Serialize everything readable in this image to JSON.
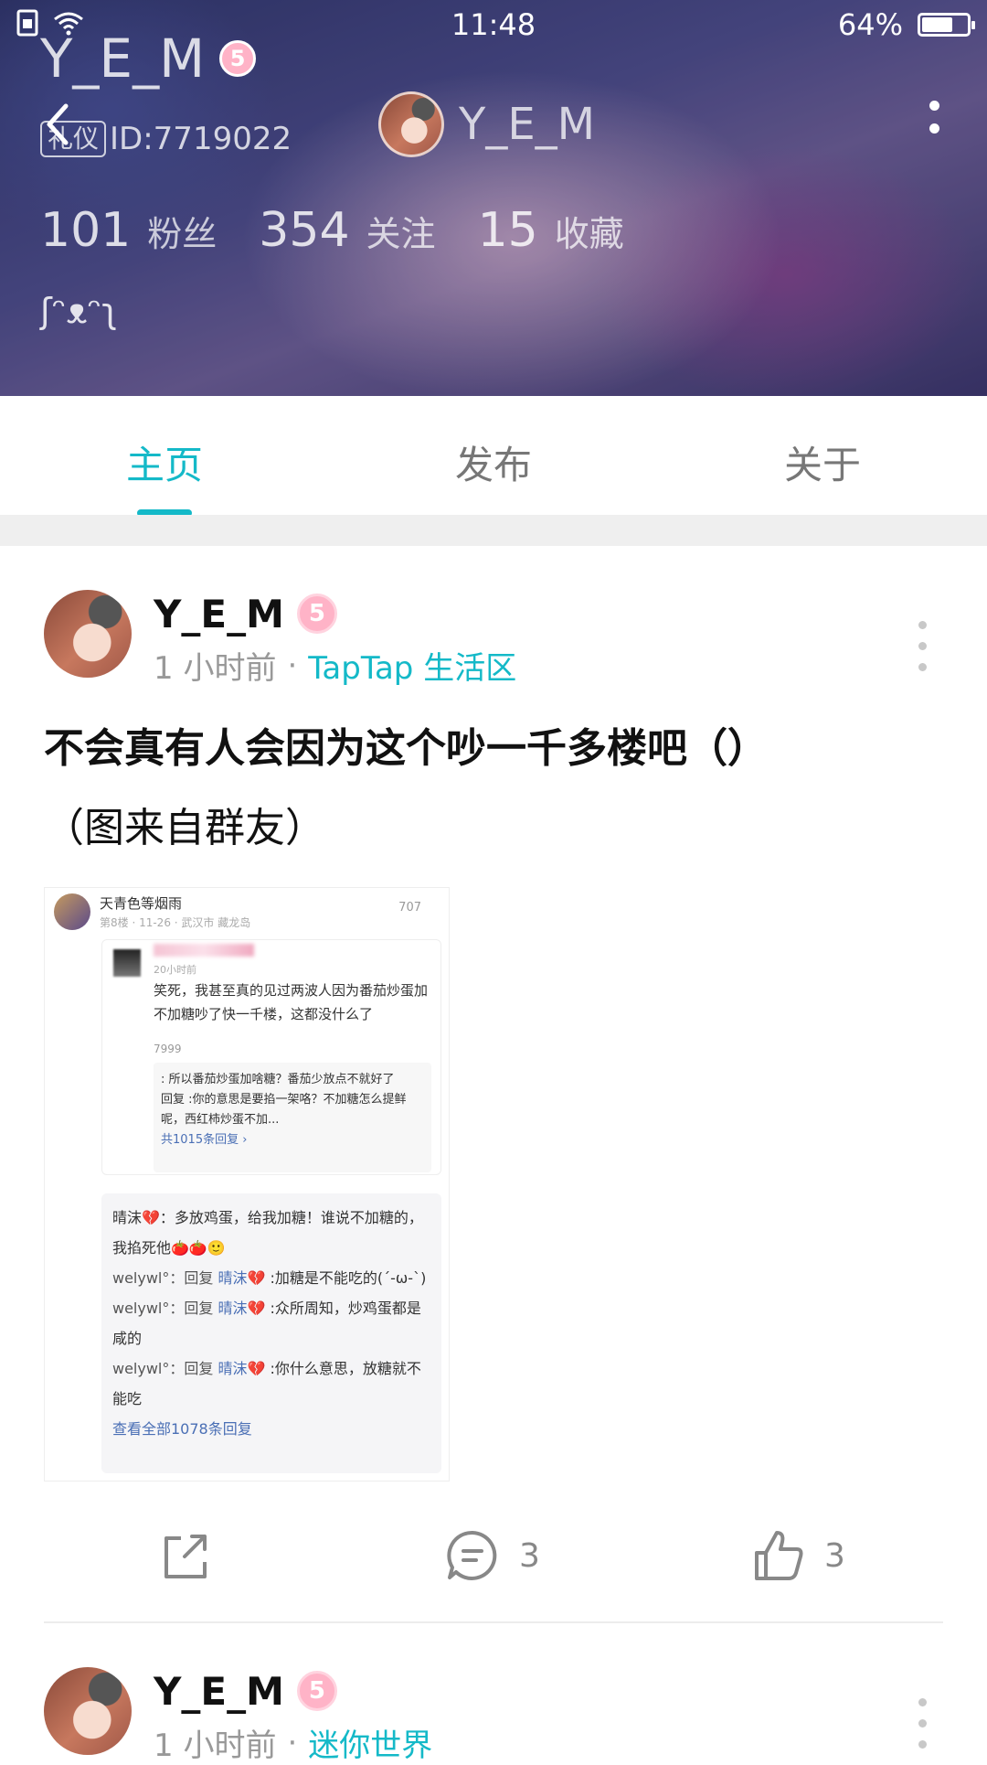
{
  "status_bar": {
    "time": "11:48",
    "battery": "64%"
  },
  "profile": {
    "name": "Y_E_M",
    "level": "5",
    "title_tag": "礼仪",
    "id_text": "ID:7719022",
    "header_title": "Y_E_M",
    "stats": [
      {
        "num": "101",
        "label": "粉丝"
      },
      {
        "num": "354",
        "label": "关注"
      },
      {
        "num": "15",
        "label": "收藏"
      }
    ],
    "signature": "ʃᵔᴥᵔʅ"
  },
  "tabs": [
    {
      "label": "主页",
      "active": true
    },
    {
      "label": "发布",
      "active": false
    },
    {
      "label": "关于",
      "active": false
    }
  ],
  "posts": [
    {
      "author": "Y_E_M",
      "level": "5",
      "time": "1 小时前",
      "separator": "·",
      "forum": "TapTap 生活区",
      "title": "不会真有人会因为这个吵一千多楼吧（）",
      "body": "（图来自群友）",
      "shares_icon": "share-icon",
      "comments": "3",
      "likes": "3",
      "image": {
        "poster": "天青色等烟雨",
        "meta": "第8楼 · 11-26 · 武汉市 藏龙岛",
        "likes": "707",
        "inner_time": "20小时前",
        "inner_text": "笑死，我甚至真的见过两波人因为番茄炒蛋加不加糖吵了快一千楼，这都没什么了",
        "inner_likes": "7999",
        "sub_line1": ": 所以番茄炒蛋加啥糖？番茄少放点不就好了",
        "sub_line2": "回复 :你的意思是要掐一架咯？不加糖怎么提鲜呢，西红柿炒蛋不加...",
        "sub_more": "共1015条回复 ›",
        "reply1": "晴沫💔：多放鸡蛋，给我加糖！谁说不加糖的，我掐死他🍅🍅🙂",
        "reply2_user": "welywl°：回复 ",
        "reply2_at": "晴沫💔",
        "reply2_text": " :加糖是不能吃的(´-ω-`)",
        "reply3_user": "welywl°：回复 ",
        "reply3_at": "晴沫💔",
        "reply3_text": " :众所周知，炒鸡蛋都是咸的",
        "reply4_user": "welywl°：回复 ",
        "reply4_at": "晴沫💔",
        "reply4_text": " :你什么意思，放糖就不能吃",
        "view_all": "查看全部1078条回复"
      }
    },
    {
      "author": "Y_E_M",
      "level": "5",
      "time": "1 小时前",
      "separator": "·",
      "forum": "迷你世界"
    }
  ],
  "colors": {
    "accent": "#14b9c8",
    "badge": "#ffb3c7"
  }
}
